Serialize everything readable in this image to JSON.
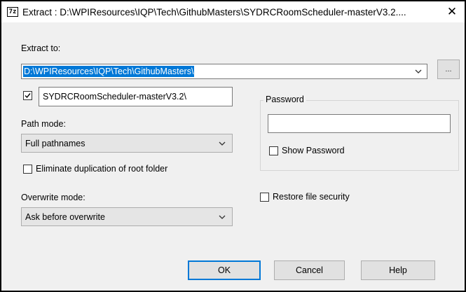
{
  "window": {
    "title": "Extract : D:\\WPIResources\\IQP\\Tech\\GithubMasters\\SYDRCRoomScheduler-masterV3.2....",
    "app_icon_text": "7z",
    "close_glyph": "✕"
  },
  "extract_to": {
    "label": "Extract to:",
    "value": "D:\\WPIResources\\IQP\\Tech\\GithubMasters\\",
    "browse_label": "..."
  },
  "subfolder": {
    "checked": true,
    "value": "SYDRCRoomScheduler-masterV3.2\\"
  },
  "path_mode": {
    "label": "Path mode:",
    "selected": "Full pathnames"
  },
  "eliminate_dup": {
    "label": "Eliminate duplication of root folder",
    "checked": false
  },
  "overwrite_mode": {
    "label": "Overwrite mode:",
    "selected": "Ask before overwrite"
  },
  "password": {
    "group_title": "Password",
    "value": "",
    "show_label": "Show Password",
    "show_checked": false
  },
  "restore_security": {
    "label": "Restore file security",
    "checked": false
  },
  "buttons": {
    "ok": "OK",
    "cancel": "Cancel",
    "help": "Help"
  },
  "colors": {
    "selection": "#0078d7",
    "default_button_border": "#0078d7",
    "dialog_bg": "#f0f0f0"
  }
}
